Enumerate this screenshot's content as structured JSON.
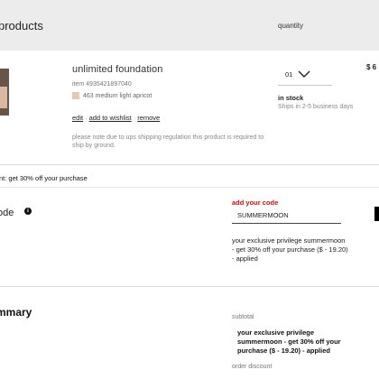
{
  "header": {
    "title": "products",
    "quantity_label": "quantity"
  },
  "product": {
    "name": "unlimited foundation",
    "item_number": "item 4935421897040",
    "shade": "463 medium light apricot",
    "swatch_color": "#e6c8b2",
    "actions": {
      "edit": "edit",
      "separator": "·",
      "wishlist": "add to wishlist",
      "remove": "remove"
    },
    "shipping_note": "please note due to ups shipping regulation this product is required to ship by ground.",
    "quantity": "01",
    "price": "$ 6",
    "stock_status": "in stock",
    "ship_time": "Ships in 2-5 business days"
  },
  "promo": {
    "banner": "nt: get 30% off your purchase",
    "section_label": "ode",
    "info_icon": "i",
    "add_code_label": "add your code",
    "code_value": "SUMMERMOON",
    "applied_message": "your exclusive privilege summermoon - get 30% off your purchase ($ - 19.20) - applied"
  },
  "summary": {
    "title": "mmary",
    "subtotal_label": "subtotal",
    "privilege_text": "your exclusive privilege summermoon - get 30% off your purchase ($ - 19.20) - applied",
    "order_discount_label": "order discount"
  },
  "colors": {
    "header_bg": "#ececec",
    "accent_red": "#c21111",
    "divider": "#dddddd"
  }
}
